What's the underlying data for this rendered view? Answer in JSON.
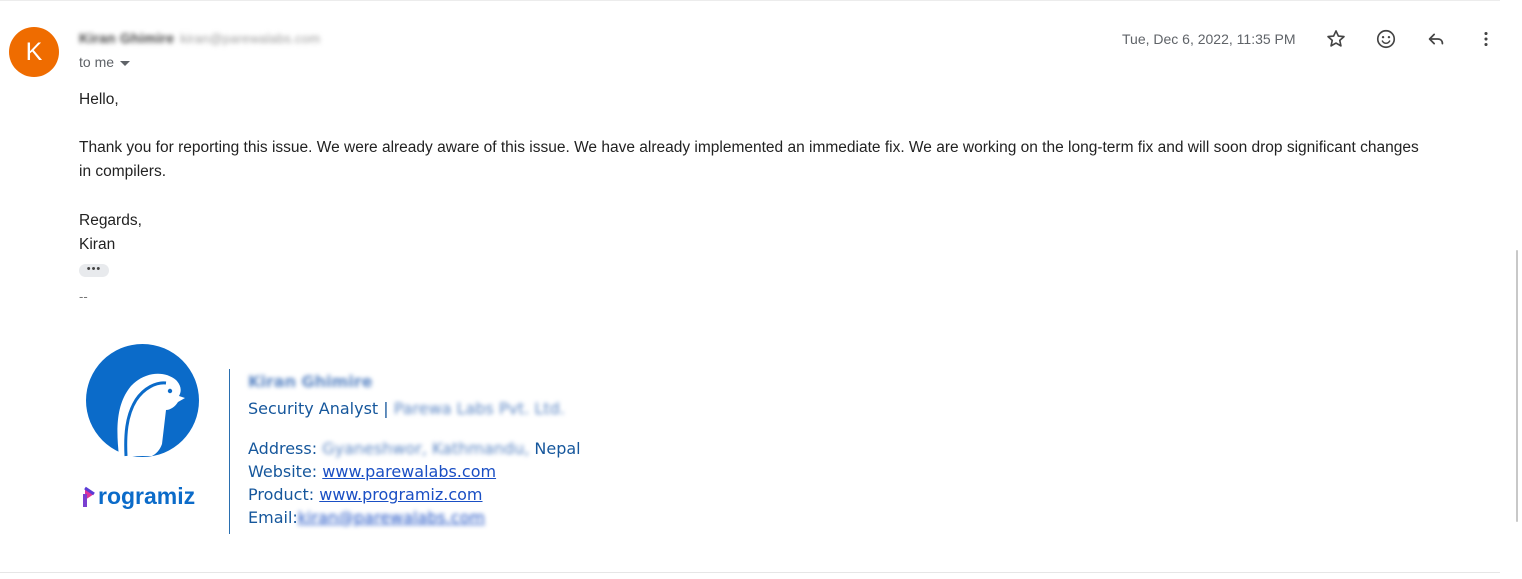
{
  "sender": {
    "initial": "K",
    "name": "Kiran Ghimire",
    "email": "kiran@parewalabs.com",
    "recipient_label": "to me"
  },
  "header": {
    "date": "Tue, Dec 6, 2022, 11:35 PM",
    "actions": [
      {
        "icon": "star-icon"
      },
      {
        "icon": "emoji-icon"
      },
      {
        "icon": "reply-icon"
      },
      {
        "icon": "more-vert-icon"
      }
    ]
  },
  "message": {
    "greeting": "Hello,",
    "paragraph_line1": "Thank you for reporting this issue. We were already aware of this issue. We have already implemented an immediate fix. We are working on the long-term fix and will soon drop significant changes",
    "paragraph_line2": "in compilers.",
    "closing": "Regards,",
    "signoff": "Kiran",
    "trimmed_content_label": "•••",
    "signature_dash": "--"
  },
  "signature": {
    "brand": "rogramiz",
    "name": "Kiran Ghimire",
    "title": "Security Analyst | ",
    "company": "Parewa Labs Pvt. Ltd.",
    "address_label": "Address: ",
    "address_blurred": "Gyaneshwor, Kathmandu,",
    "address_country": " Nepal",
    "website_label": "Website: ",
    "website": "www.parewalabs.com",
    "product_label": "Product: ",
    "product": "www.programiz.com",
    "email_label": "Email:",
    "email": "kiran@parewalabs.com"
  },
  "colors": {
    "avatar": "#ef6c00",
    "brand_blue": "#0b6bc9",
    "link": "#1a4fc4",
    "signature_text": "#16579c"
  }
}
